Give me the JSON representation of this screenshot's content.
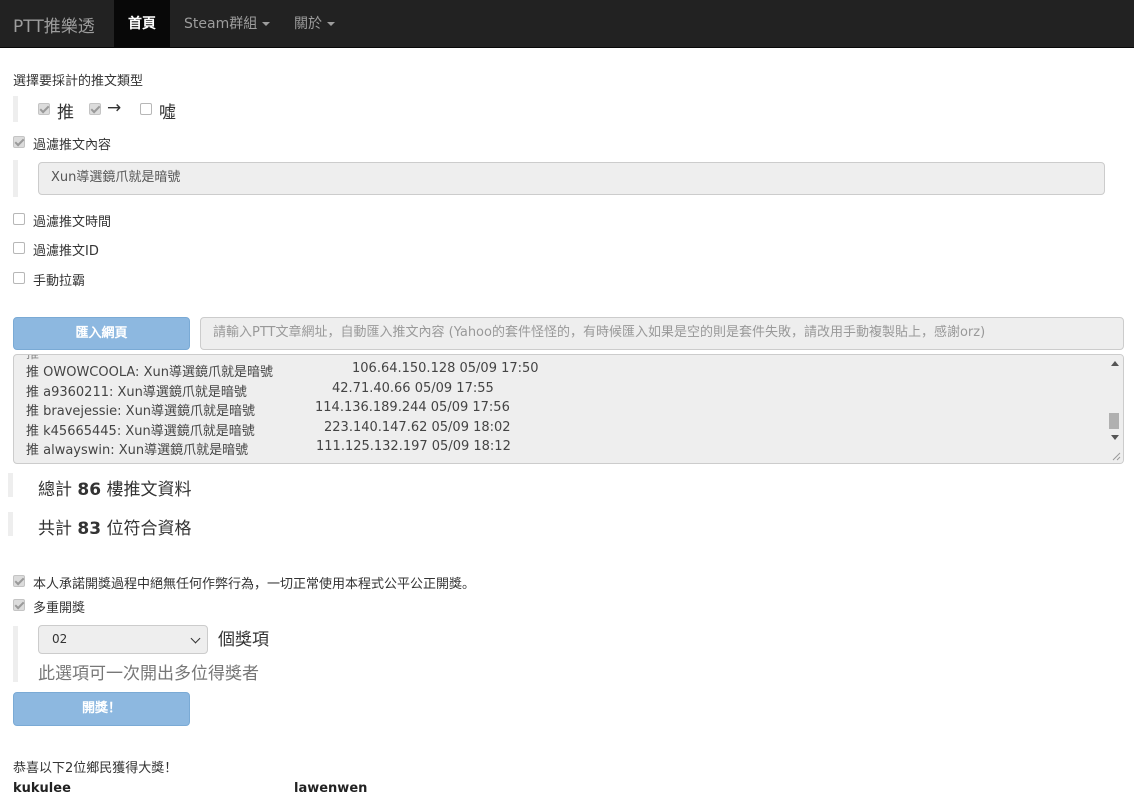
{
  "navbar": {
    "brand": "PTT推樂透",
    "items": [
      {
        "label": "首頁"
      },
      {
        "label": "Steam群組"
      },
      {
        "label": "關於"
      }
    ]
  },
  "push_type": {
    "heading": "選擇要採計的推文類型",
    "push_label": "推",
    "arrow_label": "→",
    "boo_label": "噓",
    "push_checked": true,
    "arrow_checked": true,
    "boo_checked": false
  },
  "filters": {
    "content_label": "過濾推文內容",
    "content_value": "Xun導選鏡爪就是暗號",
    "time_label": "過濾推文時間",
    "id_label": "過濾推文ID",
    "manual_label": "手動拉霸"
  },
  "import": {
    "button_label": "匯入網頁",
    "placeholder": "請輸入PTT文章網址，自動匯入推文內容 (Yahoo的套件怪怪的，有時候匯入如果是空的則是套件失敗，請改用手動複製貼上，感謝orz)"
  },
  "log": {
    "lines": [
      {
        "text": "推 OWOWCOOLA: Xun導選鏡爪就是暗號",
        "meta": "106.64.150.128 05/09 17:50"
      },
      {
        "text": "推 a9360211: Xun導選鏡爪就是暗號",
        "meta": "42.71.40.66 05/09 17:55"
      },
      {
        "text": "推 bravejessie: Xun導選鏡爪就是暗號",
        "meta": "114.136.189.244 05/09 17:56"
      },
      {
        "text": "推 k45665445: Xun導選鏡爪就是暗號",
        "meta": "223.140.147.62 05/09 18:02"
      },
      {
        "text": "推 alwayswin: Xun導選鏡爪就是暗號",
        "meta": "111.125.132.197 05/09 18:12"
      }
    ]
  },
  "stats": {
    "total_prefix": "總計",
    "total_count": "86",
    "total_suffix": "樓推文資料",
    "qualified_prefix": "共計",
    "qualified_count": "83",
    "qualified_suffix": "位符合資格"
  },
  "draw": {
    "promise_label": "本人承諾開獎過程中絕無任何作弊行為，一切正常使用本程式公平公正開獎。",
    "multi_label": "多重開獎",
    "prize_count": "02",
    "prize_suffix": "個獎項",
    "hint": "此選項可一次開出多位得獎者",
    "button_label": "開獎！"
  },
  "results": {
    "heading": "恭喜以下2位鄉民獲得大獎！",
    "winners": [
      "kukulee",
      "lawenwen"
    ]
  }
}
